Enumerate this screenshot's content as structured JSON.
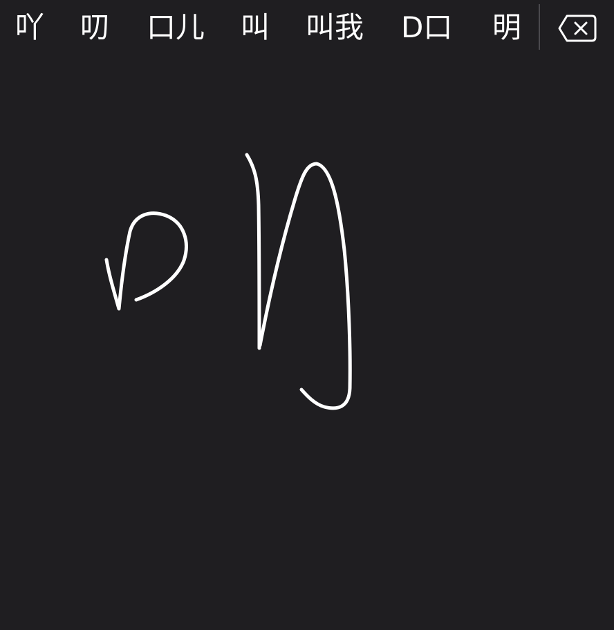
{
  "candidate_bar": {
    "candidates": [
      "吖",
      "叨",
      "口儿",
      "叫",
      "叫我",
      "D口",
      "明"
    ]
  },
  "delete_key": {
    "icon": "delete-backward-icon"
  },
  "handwriting_canvas": {
    "ink_color": "#ffffff",
    "background_color": "#1f1e21"
  }
}
